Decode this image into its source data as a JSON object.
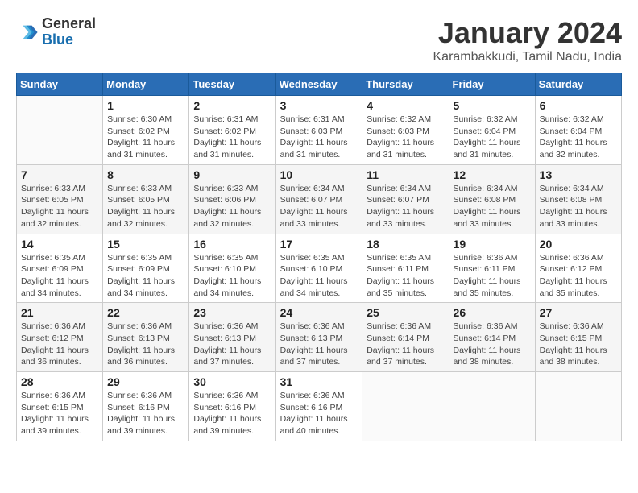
{
  "header": {
    "logo": {
      "line1": "General",
      "line2": "Blue"
    },
    "title": "January 2024",
    "subtitle": "Karambakkudi, Tamil Nadu, India"
  },
  "weekdays": [
    "Sunday",
    "Monday",
    "Tuesday",
    "Wednesday",
    "Thursday",
    "Friday",
    "Saturday"
  ],
  "weeks": [
    [
      {
        "day": "",
        "info": ""
      },
      {
        "day": "1",
        "info": "Sunrise: 6:30 AM\nSunset: 6:02 PM\nDaylight: 11 hours\nand 31 minutes."
      },
      {
        "day": "2",
        "info": "Sunrise: 6:31 AM\nSunset: 6:02 PM\nDaylight: 11 hours\nand 31 minutes."
      },
      {
        "day": "3",
        "info": "Sunrise: 6:31 AM\nSunset: 6:03 PM\nDaylight: 11 hours\nand 31 minutes."
      },
      {
        "day": "4",
        "info": "Sunrise: 6:32 AM\nSunset: 6:03 PM\nDaylight: 11 hours\nand 31 minutes."
      },
      {
        "day": "5",
        "info": "Sunrise: 6:32 AM\nSunset: 6:04 PM\nDaylight: 11 hours\nand 31 minutes."
      },
      {
        "day": "6",
        "info": "Sunrise: 6:32 AM\nSunset: 6:04 PM\nDaylight: 11 hours\nand 32 minutes."
      }
    ],
    [
      {
        "day": "7",
        "info": "Sunrise: 6:33 AM\nSunset: 6:05 PM\nDaylight: 11 hours\nand 32 minutes."
      },
      {
        "day": "8",
        "info": "Sunrise: 6:33 AM\nSunset: 6:05 PM\nDaylight: 11 hours\nand 32 minutes."
      },
      {
        "day": "9",
        "info": "Sunrise: 6:33 AM\nSunset: 6:06 PM\nDaylight: 11 hours\nand 32 minutes."
      },
      {
        "day": "10",
        "info": "Sunrise: 6:34 AM\nSunset: 6:07 PM\nDaylight: 11 hours\nand 33 minutes."
      },
      {
        "day": "11",
        "info": "Sunrise: 6:34 AM\nSunset: 6:07 PM\nDaylight: 11 hours\nand 33 minutes."
      },
      {
        "day": "12",
        "info": "Sunrise: 6:34 AM\nSunset: 6:08 PM\nDaylight: 11 hours\nand 33 minutes."
      },
      {
        "day": "13",
        "info": "Sunrise: 6:34 AM\nSunset: 6:08 PM\nDaylight: 11 hours\nand 33 minutes."
      }
    ],
    [
      {
        "day": "14",
        "info": "Sunrise: 6:35 AM\nSunset: 6:09 PM\nDaylight: 11 hours\nand 34 minutes."
      },
      {
        "day": "15",
        "info": "Sunrise: 6:35 AM\nSunset: 6:09 PM\nDaylight: 11 hours\nand 34 minutes."
      },
      {
        "day": "16",
        "info": "Sunrise: 6:35 AM\nSunset: 6:10 PM\nDaylight: 11 hours\nand 34 minutes."
      },
      {
        "day": "17",
        "info": "Sunrise: 6:35 AM\nSunset: 6:10 PM\nDaylight: 11 hours\nand 34 minutes."
      },
      {
        "day": "18",
        "info": "Sunrise: 6:35 AM\nSunset: 6:11 PM\nDaylight: 11 hours\nand 35 minutes."
      },
      {
        "day": "19",
        "info": "Sunrise: 6:36 AM\nSunset: 6:11 PM\nDaylight: 11 hours\nand 35 minutes."
      },
      {
        "day": "20",
        "info": "Sunrise: 6:36 AM\nSunset: 6:12 PM\nDaylight: 11 hours\nand 35 minutes."
      }
    ],
    [
      {
        "day": "21",
        "info": "Sunrise: 6:36 AM\nSunset: 6:12 PM\nDaylight: 11 hours\nand 36 minutes."
      },
      {
        "day": "22",
        "info": "Sunrise: 6:36 AM\nSunset: 6:13 PM\nDaylight: 11 hours\nand 36 minutes."
      },
      {
        "day": "23",
        "info": "Sunrise: 6:36 AM\nSunset: 6:13 PM\nDaylight: 11 hours\nand 37 minutes."
      },
      {
        "day": "24",
        "info": "Sunrise: 6:36 AM\nSunset: 6:13 PM\nDaylight: 11 hours\nand 37 minutes."
      },
      {
        "day": "25",
        "info": "Sunrise: 6:36 AM\nSunset: 6:14 PM\nDaylight: 11 hours\nand 37 minutes."
      },
      {
        "day": "26",
        "info": "Sunrise: 6:36 AM\nSunset: 6:14 PM\nDaylight: 11 hours\nand 38 minutes."
      },
      {
        "day": "27",
        "info": "Sunrise: 6:36 AM\nSunset: 6:15 PM\nDaylight: 11 hours\nand 38 minutes."
      }
    ],
    [
      {
        "day": "28",
        "info": "Sunrise: 6:36 AM\nSunset: 6:15 PM\nDaylight: 11 hours\nand 39 minutes."
      },
      {
        "day": "29",
        "info": "Sunrise: 6:36 AM\nSunset: 6:16 PM\nDaylight: 11 hours\nand 39 minutes."
      },
      {
        "day": "30",
        "info": "Sunrise: 6:36 AM\nSunset: 6:16 PM\nDaylight: 11 hours\nand 39 minutes."
      },
      {
        "day": "31",
        "info": "Sunrise: 6:36 AM\nSunset: 6:16 PM\nDaylight: 11 hours\nand 40 minutes."
      },
      {
        "day": "",
        "info": ""
      },
      {
        "day": "",
        "info": ""
      },
      {
        "day": "",
        "info": ""
      }
    ]
  ]
}
